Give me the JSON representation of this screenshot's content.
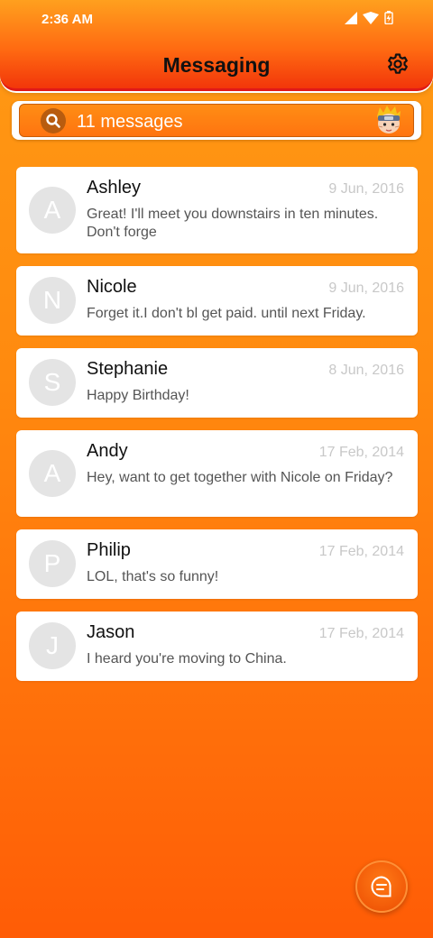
{
  "status_bar": {
    "time": "2:36 AM"
  },
  "header": {
    "title": "Messaging"
  },
  "search": {
    "text": "11 messages"
  },
  "conversations": [
    {
      "initial": "A",
      "name": "Ashley",
      "date": "9 Jun, 2016",
      "preview": "Great! I'll meet you downstairs in ten minutes. Don't forge"
    },
    {
      "initial": "N",
      "name": "Nicole",
      "date": "9 Jun, 2016",
      "preview": "Forget it.I don't bl get paid. until next Friday."
    },
    {
      "initial": "S",
      "name": "Stephanie",
      "date": "8 Jun, 2016",
      "preview": "Happy Birthday!"
    },
    {
      "initial": "A",
      "name": "Andy",
      "date": "17 Feb, 2014",
      "preview": "Hey, want to get together with Nicole on Friday?"
    },
    {
      "initial": "P",
      "name": "Philip",
      "date": "17 Feb, 2014",
      "preview": "LOL, that's so funny!"
    },
    {
      "initial": "J",
      "name": "Jason",
      "date": "17 Feb, 2014",
      "preview": "I heard you're moving to China."
    }
  ],
  "icons": {
    "search": "search-icon",
    "settings": "gear-icon",
    "compose": "message-icon",
    "signal": "signal-icon",
    "wifi": "wifi-icon",
    "battery": "battery-icon"
  },
  "colors": {
    "accent": "#ff8a0f",
    "header_border": "#e01818",
    "card_bg": "#ffffff"
  }
}
